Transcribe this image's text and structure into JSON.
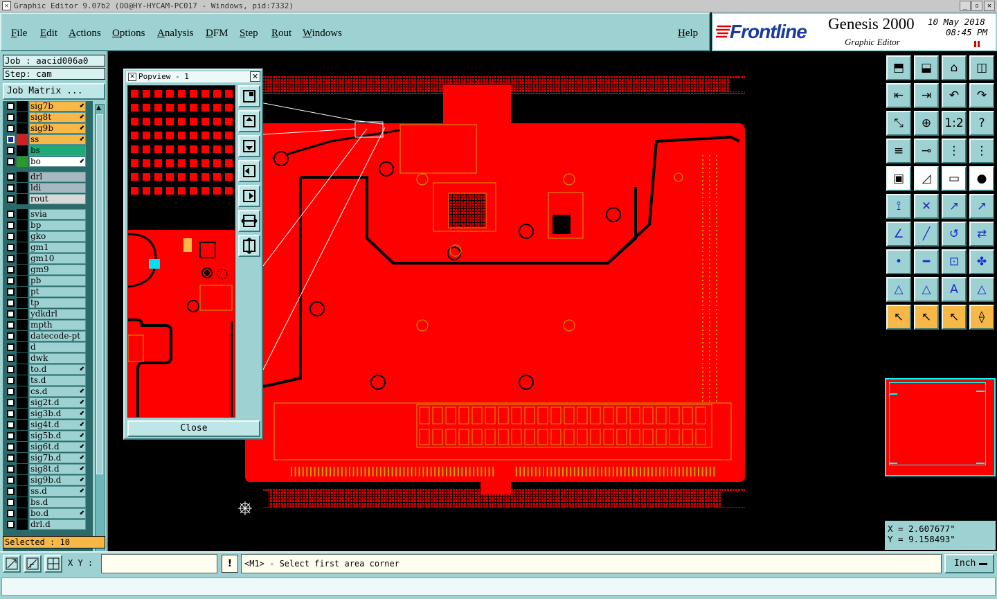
{
  "window": {
    "title": "Graphic Editor 9.07b2 (OO@HY-HYCAM-PC017 - Windows, pid:7332)",
    "controls": [
      "_",
      "▫",
      "✕"
    ]
  },
  "menu": {
    "items": [
      "File",
      "Edit",
      "Actions",
      "Options",
      "Analysis",
      "DFM",
      "Step",
      "Rout",
      "Windows"
    ],
    "help": "Help"
  },
  "brand": {
    "logo": "Frontline",
    "product": "Genesis 2000",
    "subtitle": "Graphic Editor",
    "date": "10 May 2018",
    "time": "08:45 PM"
  },
  "job": {
    "job_label": "Job : aacid006a0",
    "step_label": "Step: cam",
    "matrix_button": "Job Matrix ..."
  },
  "layers": [
    {
      "name": "sig7b",
      "color": "#f8b848",
      "arrow": true
    },
    {
      "name": "sig8t",
      "color": "#f8b848",
      "arrow": true
    },
    {
      "name": "sig9b",
      "color": "#f8b848",
      "arrow": true
    },
    {
      "name": "ss",
      "color": "#f8b848",
      "arrow": true,
      "work": true
    },
    {
      "name": "bs",
      "color": "#20a878",
      "arrow": false
    },
    {
      "name": "bo",
      "color": "#ffffff",
      "arrow": true
    },
    {
      "name": "drl",
      "color": "#a8b8c0",
      "arrow": false
    },
    {
      "name": "ldi",
      "color": "#a8b8c0",
      "arrow": false
    },
    {
      "name": "rout",
      "color": "#d8d8d8",
      "arrow": false
    },
    {
      "name": "svia",
      "color": "#9ed2d2",
      "arrow": false
    },
    {
      "name": "bp",
      "color": "#9ed2d2",
      "arrow": false
    },
    {
      "name": "gko",
      "color": "#9ed2d2",
      "arrow": false
    },
    {
      "name": "gm1",
      "color": "#9ed2d2",
      "arrow": false
    },
    {
      "name": "gm10",
      "color": "#9ed2d2",
      "arrow": false
    },
    {
      "name": "gm9",
      "color": "#9ed2d2",
      "arrow": false
    },
    {
      "name": "pb",
      "color": "#9ed2d2",
      "arrow": false
    },
    {
      "name": "pt",
      "color": "#9ed2d2",
      "arrow": false
    },
    {
      "name": "tp",
      "color": "#9ed2d2",
      "arrow": false
    },
    {
      "name": "ydkdrl",
      "color": "#9ed2d2",
      "arrow": false
    },
    {
      "name": "mpth",
      "color": "#9ed2d2",
      "arrow": false
    },
    {
      "name": "datecode-pt",
      "color": "#9ed2d2",
      "arrow": false
    },
    {
      "name": "d",
      "color": "#9ed2d2",
      "arrow": false
    },
    {
      "name": "dwk",
      "color": "#9ed2d2",
      "arrow": false
    },
    {
      "name": "to.d",
      "color": "#9ed2d2",
      "arrow": true
    },
    {
      "name": "ts.d",
      "color": "#9ed2d2",
      "arrow": false
    },
    {
      "name": "cs.d",
      "color": "#9ed2d2",
      "arrow": true
    },
    {
      "name": "sig2t.d",
      "color": "#9ed2d2",
      "arrow": true
    },
    {
      "name": "sig3b.d",
      "color": "#9ed2d2",
      "arrow": true
    },
    {
      "name": "sig4t.d",
      "color": "#9ed2d2",
      "arrow": true
    },
    {
      "name": "sig5b.d",
      "color": "#9ed2d2",
      "arrow": true
    },
    {
      "name": "sig6t.d",
      "color": "#9ed2d2",
      "arrow": true
    },
    {
      "name": "sig7b.d",
      "color": "#9ed2d2",
      "arrow": true
    },
    {
      "name": "sig8t.d",
      "color": "#9ed2d2",
      "arrow": true
    },
    {
      "name": "sig9b.d",
      "color": "#9ed2d2",
      "arrow": true
    },
    {
      "name": "ss.d",
      "color": "#9ed2d2",
      "arrow": true
    },
    {
      "name": "bs.d",
      "color": "#9ed2d2",
      "arrow": false
    },
    {
      "name": "bo.d",
      "color": "#9ed2d2",
      "arrow": true
    },
    {
      "name": "drl.d",
      "color": "#9ed2d2",
      "arrow": false
    }
  ],
  "selection": {
    "label": "Selected : 10"
  },
  "popview": {
    "title": "Popview - 1",
    "close_label": "Close"
  },
  "coords": {
    "x": "X = 2.607677\"",
    "y": "Y = 9.158493\""
  },
  "bottom": {
    "xy_label": "X Y :",
    "xy_value": "",
    "bang": "!",
    "prompt": "<M1> - Select first area corner",
    "unit": "Inch"
  },
  "colors": {
    "panel": "#9ed2d2",
    "board": "#ff0000",
    "highlight": "#f8b848"
  }
}
